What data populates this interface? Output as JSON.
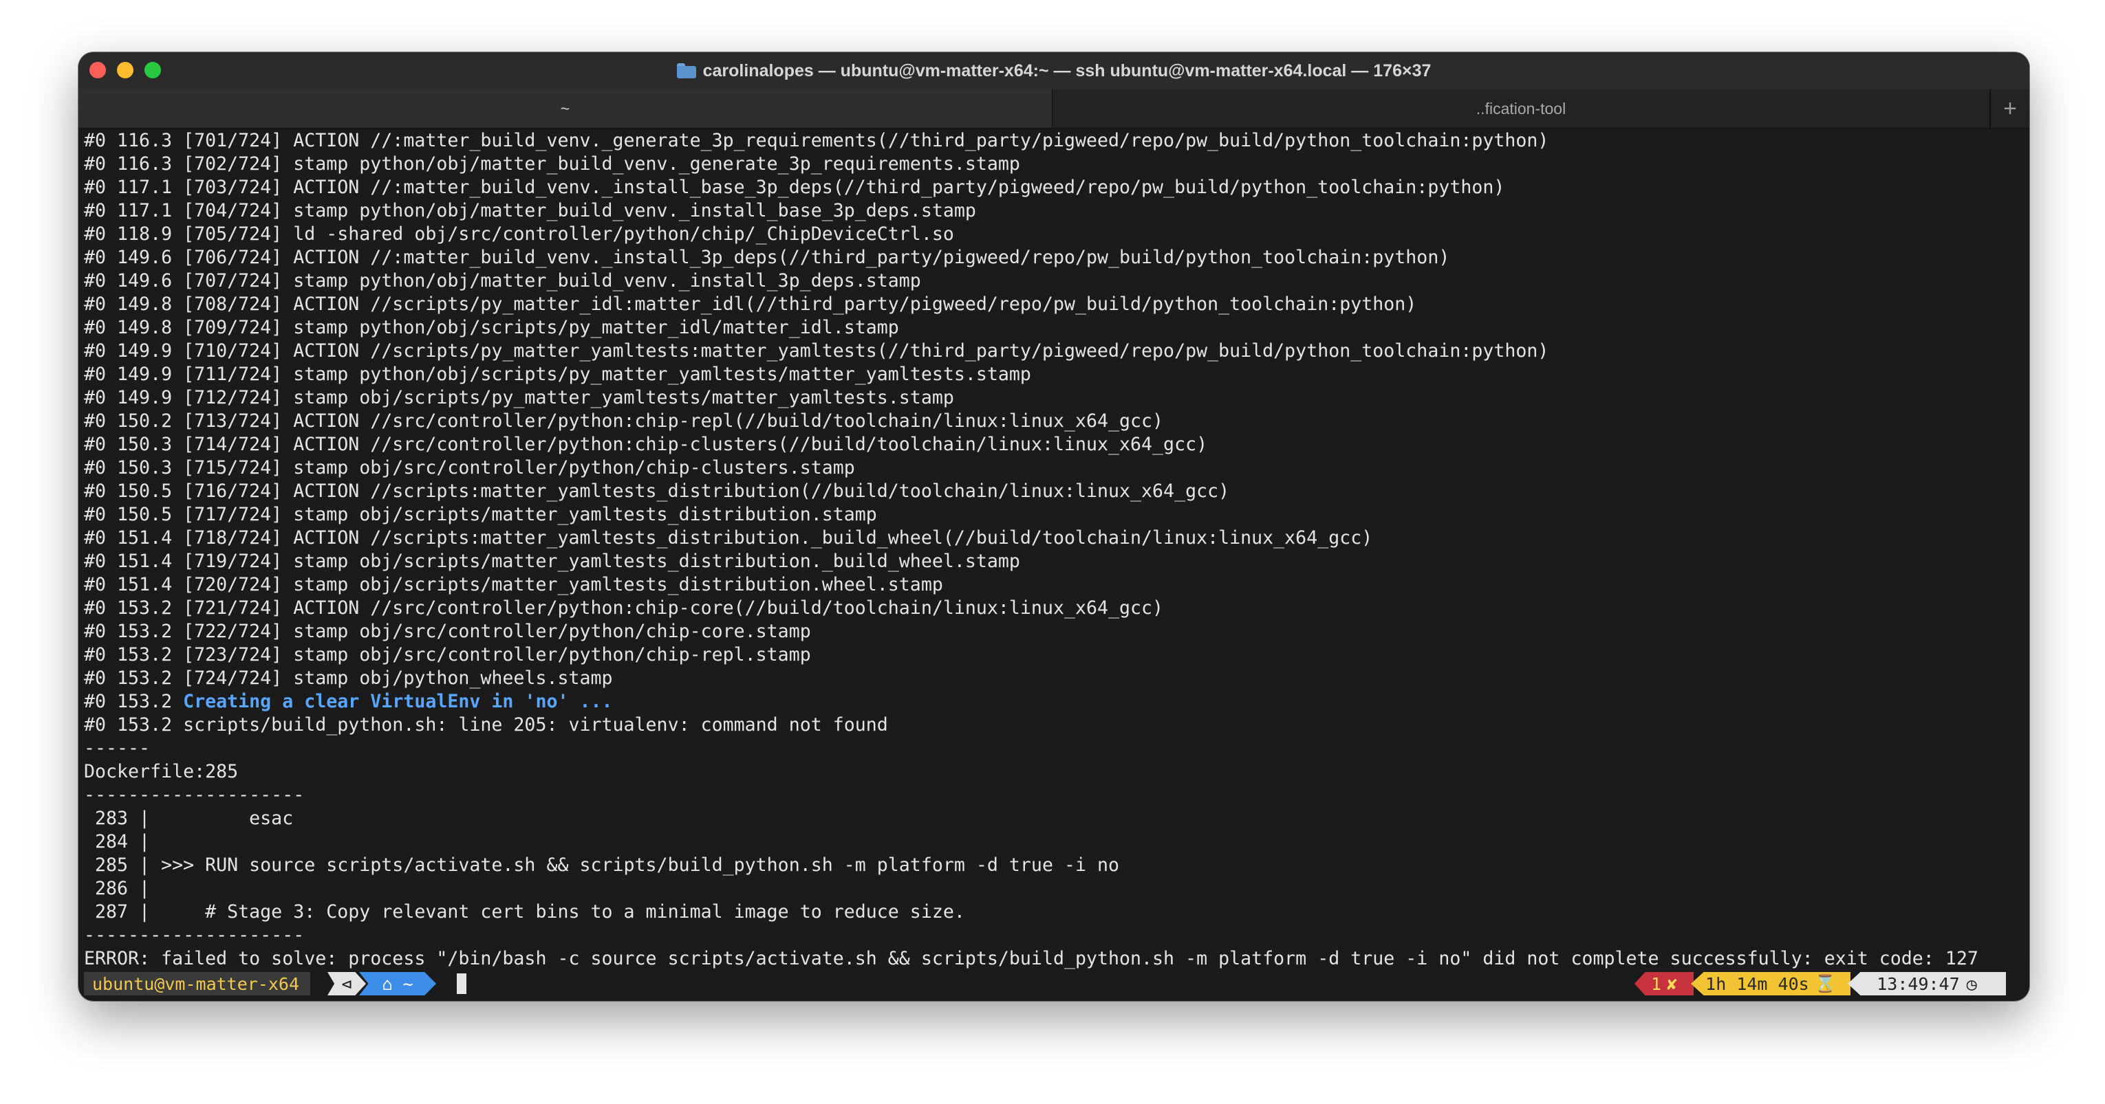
{
  "window": {
    "title": "carolinalopes — ubuntu@vm-matter-x64:~ — ssh ubuntu@vm-matter-x64.local — 176×37"
  },
  "tabs": [
    {
      "label": "~",
      "active": true
    },
    {
      "label": "..fication-tool",
      "active": false
    }
  ],
  "new_tab_label": "+",
  "terminal": {
    "lines": [
      {
        "text": "#0 116.3 [701/724] ACTION //:matter_build_venv._generate_3p_requirements(//third_party/pigweed/repo/pw_build/python_toolchain:python)"
      },
      {
        "text": "#0 116.3 [702/724] stamp python/obj/matter_build_venv._generate_3p_requirements.stamp"
      },
      {
        "text": "#0 117.1 [703/724] ACTION //:matter_build_venv._install_base_3p_deps(//third_party/pigweed/repo/pw_build/python_toolchain:python)"
      },
      {
        "text": "#0 117.1 [704/724] stamp python/obj/matter_build_venv._install_base_3p_deps.stamp"
      },
      {
        "text": "#0 118.9 [705/724] ld -shared obj/src/controller/python/chip/_ChipDeviceCtrl.so"
      },
      {
        "text": "#0 149.6 [706/724] ACTION //:matter_build_venv._install_3p_deps(//third_party/pigweed/repo/pw_build/python_toolchain:python)"
      },
      {
        "text": "#0 149.6 [707/724] stamp python/obj/matter_build_venv._install_3p_deps.stamp"
      },
      {
        "text": "#0 149.8 [708/724] ACTION //scripts/py_matter_idl:matter_idl(//third_party/pigweed/repo/pw_build/python_toolchain:python)"
      },
      {
        "text": "#0 149.8 [709/724] stamp python/obj/scripts/py_matter_idl/matter_idl.stamp"
      },
      {
        "text": "#0 149.9 [710/724] ACTION //scripts/py_matter_yamltests:matter_yamltests(//third_party/pigweed/repo/pw_build/python_toolchain:python)"
      },
      {
        "text": "#0 149.9 [711/724] stamp python/obj/scripts/py_matter_yamltests/matter_yamltests.stamp"
      },
      {
        "text": "#0 149.9 [712/724] stamp obj/scripts/py_matter_yamltests/matter_yamltests.stamp"
      },
      {
        "text": "#0 150.2 [713/724] ACTION //src/controller/python:chip-repl(//build/toolchain/linux:linux_x64_gcc)"
      },
      {
        "text": "#0 150.3 [714/724] ACTION //src/controller/python:chip-clusters(//build/toolchain/linux:linux_x64_gcc)"
      },
      {
        "text": "#0 150.3 [715/724] stamp obj/src/controller/python/chip-clusters.stamp"
      },
      {
        "text": "#0 150.5 [716/724] ACTION //scripts:matter_yamltests_distribution(//build/toolchain/linux:linux_x64_gcc)"
      },
      {
        "text": "#0 150.5 [717/724] stamp obj/scripts/matter_yamltests_distribution.stamp"
      },
      {
        "text": "#0 151.4 [718/724] ACTION //scripts:matter_yamltests_distribution._build_wheel(//build/toolchain/linux:linux_x64_gcc)"
      },
      {
        "text": "#0 151.4 [719/724] stamp obj/scripts/matter_yamltests_distribution._build_wheel.stamp"
      },
      {
        "text": "#0 151.4 [720/724] stamp obj/scripts/matter_yamltests_distribution.wheel.stamp"
      },
      {
        "text": "#0 153.2 [721/724] ACTION //src/controller/python:chip-core(//build/toolchain/linux:linux_x64_gcc)"
      },
      {
        "text": "#0 153.2 [722/724] stamp obj/src/controller/python/chip-core.stamp"
      },
      {
        "text": "#0 153.2 [723/724] stamp obj/src/controller/python/chip-repl.stamp"
      },
      {
        "text": "#0 153.2 [724/724] stamp obj/python_wheels.stamp"
      },
      {
        "text": "#0 153.2 ",
        "highlight": "Creating a clear VirtualEnv in 'no' ..."
      },
      {
        "text": "#0 153.2 scripts/build_python.sh: line 205: virtualenv: command not found"
      },
      {
        "text": "------"
      },
      {
        "text": "Dockerfile:285"
      },
      {
        "text": "--------------------"
      },
      {
        "text": " 283 |         esac"
      },
      {
        "text": " 284 |"
      },
      {
        "text": " 285 | >>> RUN source scripts/activate.sh && scripts/build_python.sh -m platform -d true -i no"
      },
      {
        "text": " 286 |"
      },
      {
        "text": " 287 |     # Stage 3: Copy relevant cert bins to a minimal image to reduce size."
      },
      {
        "text": "--------------------"
      },
      {
        "text": "ERROR: failed to solve: process \"/bin/bash -c source scripts/activate.sh && scripts/build_python.sh -m platform -d true -i no\" did not complete successfully: exit code: 127"
      }
    ]
  },
  "prompt": {
    "user_host": "ubuntu@vm-matter-x64",
    "git_icon": "git-icon",
    "dir_icon": "home-icon",
    "dir": "~",
    "error_count": "1",
    "error_mark": "✘",
    "duration": "1h 14m 40s",
    "duration_icon": "hourglass-icon",
    "clock": "13:49:47",
    "clock_icon": "clock-icon"
  },
  "colors": {
    "terminal_bg": "#1b1b1b",
    "highlight": "#58a6ff",
    "prompt_user": "#f2c94c",
    "prompt_dir_bg": "#3d8ee8",
    "prompt_error_bg": "#c8323c",
    "prompt_duration_bg": "#f2c433"
  }
}
